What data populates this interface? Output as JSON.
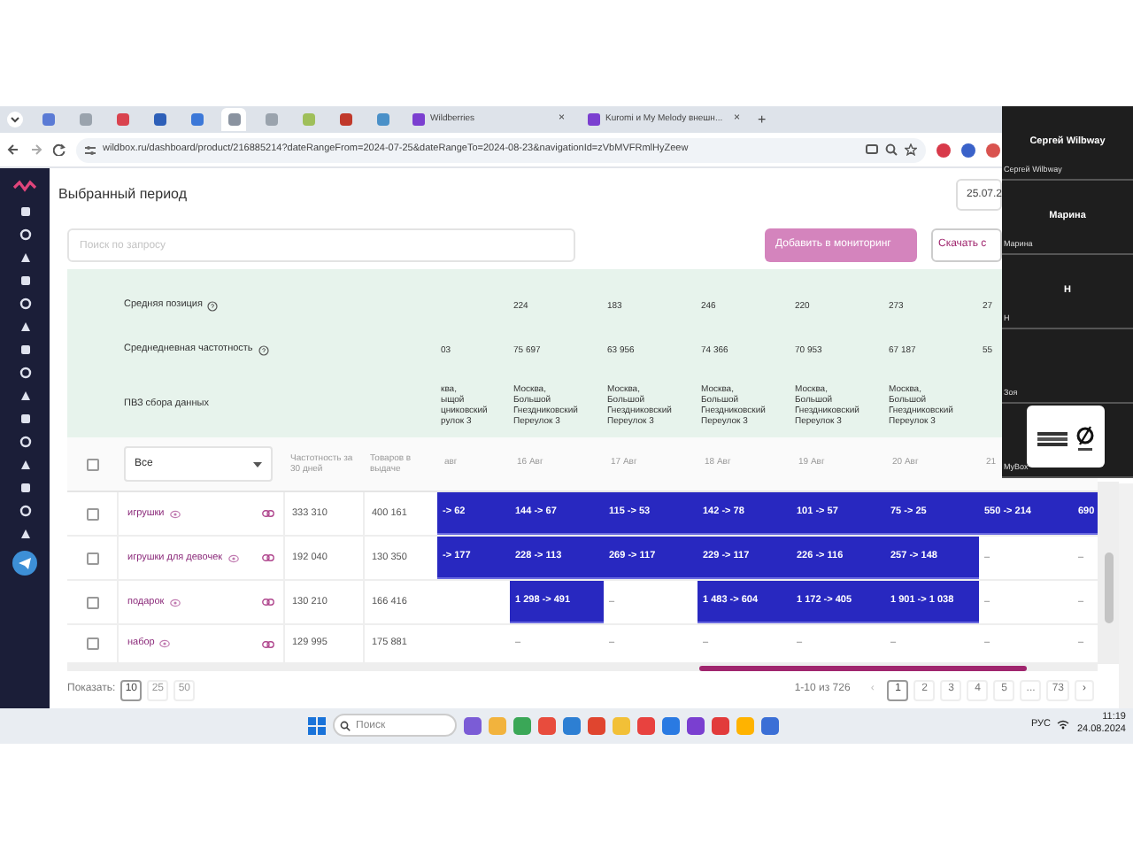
{
  "browser": {
    "pinned_tabs": [
      {
        "color": "#5b7bd5",
        "selected": false
      },
      {
        "color": "#9aa3ad",
        "selected": false
      },
      {
        "color": "#d9434f",
        "selected": false
      },
      {
        "color": "#2d5fb8",
        "selected": false
      },
      {
        "color": "#3c78d8",
        "selected": false
      },
      {
        "color": "#8a93a0",
        "selected": true
      },
      {
        "color": "#9aa3ad",
        "selected": false
      },
      {
        "color": "#9fbf5a",
        "selected": false
      },
      {
        "color": "#c0392b",
        "selected": false
      },
      {
        "color": "#4a90c8",
        "selected": false
      }
    ],
    "tabs": [
      {
        "label": "Wildberries",
        "close": "×",
        "selected": false
      },
      {
        "label": "Kuromi и My Melody внешн...",
        "close": "×",
        "selected": false
      }
    ],
    "new_tab": "+",
    "url": "wildbox.ru/dashboard/product/216885214?dateRangeFrom=2024-07-25&dateRangeTo=2024-08-23&navigationId=zVbMVFRmlHyZeew"
  },
  "page": {
    "title": "Выбранный период",
    "date": "25.07.2",
    "search": {
      "placeholder": "Поиск по запросу"
    },
    "buttons": [
      {
        "label": "Добавить в мониторинг",
        "kind": "primary"
      },
      {
        "label": "Скачать с",
        "kind": "outline"
      }
    ]
  },
  "summary": [
    {
      "label": "Средняя позиция",
      "help": true,
      "first_date_blank": true,
      "values": [
        {
          "text": "224"
        },
        {
          "text": "183"
        },
        {
          "text": "246"
        },
        {
          "text": "220"
        },
        {
          "text": "273"
        },
        {
          "text": "27"
        }
      ]
    },
    {
      "label": "Среднедневная частотность",
      "help": true,
      "values": [
        {
          "text": "03"
        },
        {
          "text": "75 697"
        },
        {
          "text": "63 956"
        },
        {
          "text": "74 366"
        },
        {
          "text": "70 953"
        },
        {
          "text": "67 187"
        },
        {
          "text": "55"
        }
      ]
    },
    {
      "label": "ПВЗ сбора данных",
      "help": false,
      "values": [
        {
          "text": "ква,\nыщой\nцниковский\nрулок 3"
        },
        {
          "text": "Москва,\nБольшой\nГнездниковский\nПереулок 3"
        },
        {
          "text": "Москва,\nБольшой\nГнездниковский\nПереулок 3"
        },
        {
          "text": "Москва,\nБольшой\nГнездниковский\nПереулок 3"
        },
        {
          "text": "Москва,\nБольшой\nГнездниковский\nПереулок 3"
        },
        {
          "text": "Москва,\nБольшой\nГнездниковский\nПереулок 3"
        }
      ]
    }
  ],
  "table": {
    "all_checked": false,
    "filter": "Все",
    "columns": [
      "Частотность за 30 дней",
      "Товаров в выдаче"
    ],
    "dates": [
      "авг",
      "16 Авг",
      "17 Авг",
      "18 Авг",
      "19 Авг",
      "20 Авг",
      "21"
    ],
    "rows": [
      {
        "keyword": "игрушки",
        "checked": false,
        "frequency": "333 310",
        "goods": "400 161",
        "cells": [
          {
            "text": "-> 62",
            "highlighted": true
          },
          {
            "text": "144 -> 67",
            "highlighted": true
          },
          {
            "text": "115 -> 53",
            "highlighted": true
          },
          {
            "text": "142 -> 78",
            "highlighted": true
          },
          {
            "text": "101 -> 57",
            "highlighted": true
          },
          {
            "text": "75 -> 25",
            "highlighted": true
          },
          {
            "text": "550 -> 214",
            "highlighted": true
          },
          {
            "text": "690",
            "highlighted": true
          }
        ]
      },
      {
        "keyword": "игрушки для девочек",
        "checked": false,
        "frequency": "192 040",
        "goods": "130 350",
        "cells": [
          {
            "text": "-> 177",
            "highlighted": true
          },
          {
            "text": "228 -> 113",
            "highlighted": true
          },
          {
            "text": "269 -> 117",
            "highlighted": true
          },
          {
            "text": "229 -> 117",
            "highlighted": true
          },
          {
            "text": "226 -> 116",
            "highlighted": true
          },
          {
            "text": "257 -> 148",
            "highlighted": true
          },
          {
            "text": "–",
            "highlighted": false
          },
          {
            "text": "–",
            "highlighted": false
          }
        ]
      },
      {
        "keyword": "подарок",
        "checked": false,
        "frequency": "130 210",
        "goods": "166 416",
        "cells": [
          {
            "highlighted": false
          },
          {
            "text": "1 298 -> 491",
            "highlighted": true
          },
          {
            "text": "–",
            "highlighted": false
          },
          {
            "text": "1 483 -> 604",
            "highlighted": true
          },
          {
            "text": "1 172 -> 405",
            "highlighted": true
          },
          {
            "text": "1 901 -> 1 038",
            "highlighted": true
          },
          {
            "text": "–",
            "highlighted": false
          },
          {
            "text": "–",
            "highlighted": false
          }
        ]
      },
      {
        "keyword": "набор",
        "checked": false,
        "frequency": "129 995",
        "goods": "175 881",
        "cells": [
          {
            "highlighted": false
          },
          {
            "text": "–",
            "highlighted": false
          },
          {
            "text": "–",
            "highlighted": false
          },
          {
            "text": "–",
            "highlighted": false
          },
          {
            "text": "–",
            "highlighted": false
          },
          {
            "text": "–",
            "highlighted": false
          },
          {
            "text": "–",
            "highlighted": false
          },
          {
            "text": "–",
            "highlighted": false
          }
        ]
      }
    ]
  },
  "pagination": {
    "label": "Показать:",
    "sizes": [
      {
        "label": "10",
        "selected": true
      },
      {
        "label": "25",
        "selected": false
      },
      {
        "label": "50",
        "selected": false
      }
    ],
    "range": "1-10 из 726",
    "prev": "‹",
    "next": "›",
    "pages": [
      {
        "label": "1",
        "selected": true
      },
      {
        "label": "2",
        "selected": false
      },
      {
        "label": "3",
        "selected": false
      },
      {
        "label": "4",
        "selected": false
      },
      {
        "label": "5",
        "selected": false
      },
      {
        "label": "...",
        "selected": false
      },
      {
        "label": "73",
        "selected": false
      }
    ]
  },
  "call_tiles": [
    {
      "kind": "name",
      "name": "Сергей Wilbway",
      "caption": "Сергей Wilbway"
    },
    {
      "kind": "name",
      "name": "Марина",
      "caption": "Марина"
    },
    {
      "kind": "name",
      "name": "Н",
      "caption": "Н"
    },
    {
      "kind": "blank",
      "caption": "Зоя"
    },
    {
      "kind": "logo",
      "caption": "MyBox"
    }
  ],
  "taskbar": {
    "search": {
      "placeholder": "Поиск"
    },
    "language": "РУС",
    "time": "11:19",
    "date": "24.08.2024"
  }
}
